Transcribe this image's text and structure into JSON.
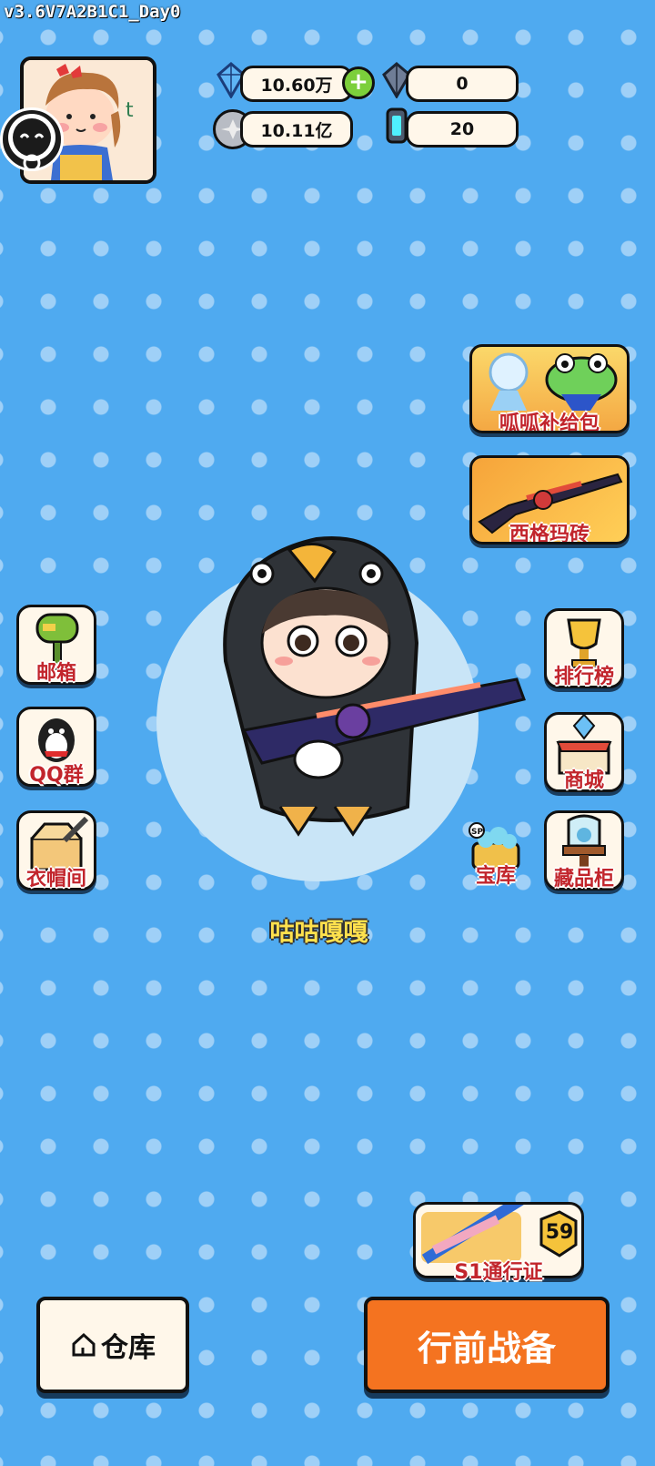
{
  "version": "v3.6V7A2B1C1_Day0",
  "currency": {
    "diamond": "10.60万",
    "dark_crystal": "0",
    "coin": "10.11亿",
    "energy": "20"
  },
  "promos": {
    "supply_pack": "呱呱补给包",
    "sig_brick": "西格玛砖"
  },
  "left_menu": [
    {
      "label": "邮箱",
      "icon": "mailbox-icon"
    },
    {
      "label": "QQ群",
      "icon": "penguin-icon"
    },
    {
      "label": "衣帽间",
      "icon": "wardrobe-box-icon"
    }
  ],
  "right_menu": [
    {
      "label": "排行榜",
      "icon": "trophy-icon"
    },
    {
      "label": "商城",
      "icon": "shop-icon"
    },
    {
      "label": "宝库",
      "icon": "treasure-icon"
    },
    {
      "label": "藏品柜",
      "icon": "collection-cabinet-icon"
    }
  ],
  "character": {
    "name": "咕咕嘎嘎"
  },
  "battle_pass": {
    "label": "S1通行证",
    "level": "59"
  },
  "bottom": {
    "warehouse_label": "仓库",
    "prepare_label": "行前战备"
  },
  "colors": {
    "background": "#4faaf0",
    "prepare_button": "#f47320",
    "label_red": "#c2252c"
  }
}
